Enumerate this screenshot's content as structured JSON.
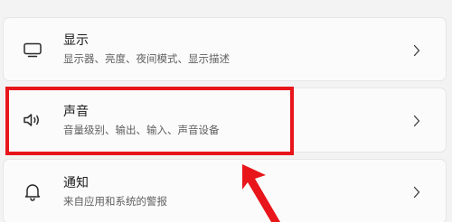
{
  "settings": {
    "items": [
      {
        "title": "显示",
        "subtitle": "显示器、亮度、夜间模式、显示描述",
        "icon": "monitor-icon"
      },
      {
        "title": "声音",
        "subtitle": "音量级别、输出、输入、声音设备",
        "icon": "speaker-icon"
      },
      {
        "title": "通知",
        "subtitle": "来自应用和系统的警报",
        "icon": "bell-icon"
      }
    ]
  },
  "annotation": {
    "highlight_color": "#e8151b"
  },
  "colors": {
    "background": "#f3f3f3",
    "card": "#fbfbfb",
    "title_text": "#1b1b1b",
    "subtitle_text": "#5f5f5f"
  }
}
